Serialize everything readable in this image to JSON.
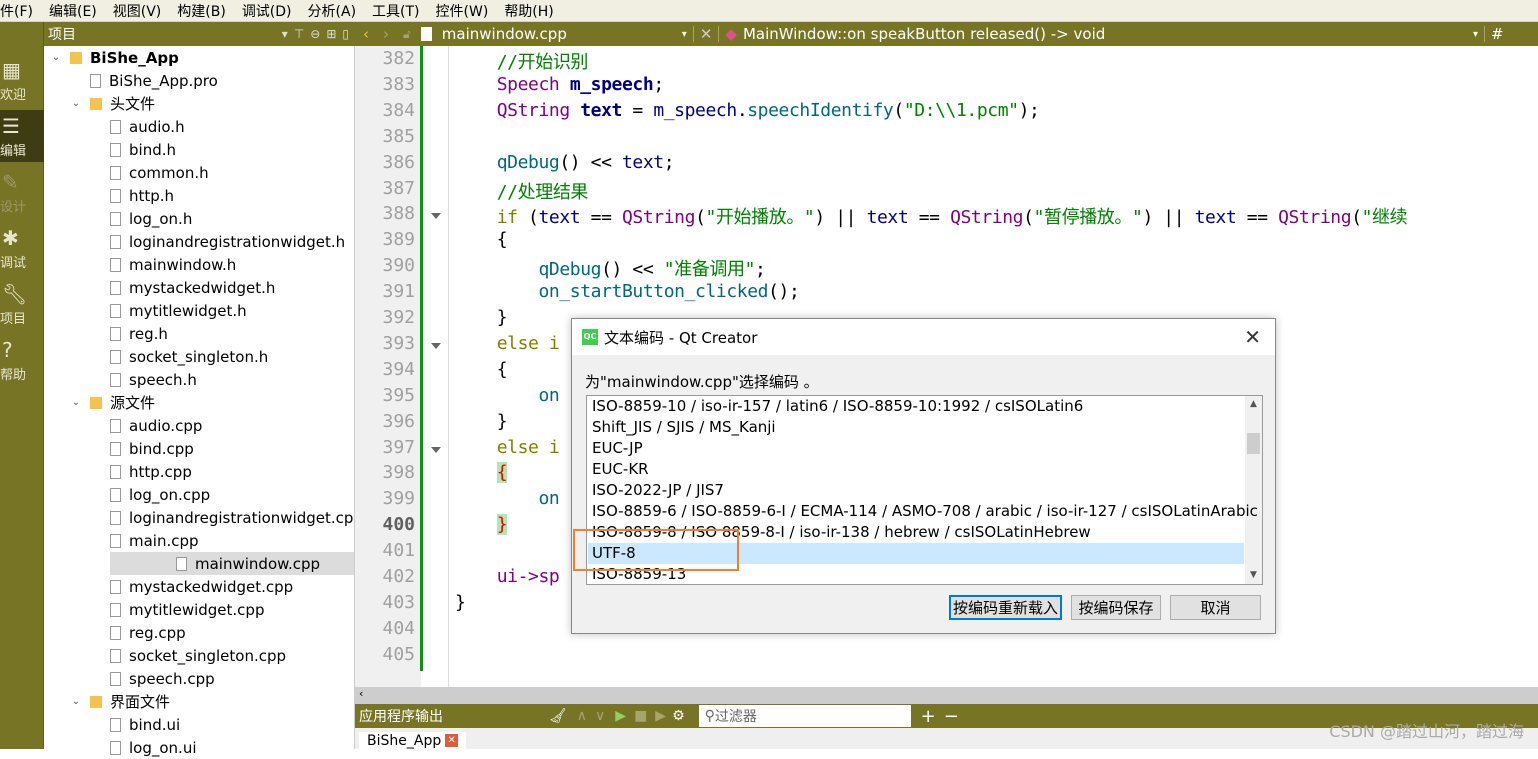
{
  "menu": [
    "件(F)",
    "编辑(E)",
    "视图(V)",
    "构建(B)",
    "调试(D)",
    "分析(A)",
    "工具(T)",
    "控件(W)",
    "帮助(H)"
  ],
  "modes": [
    {
      "label": "欢迎",
      "icon": "grid-icon"
    },
    {
      "label": "编辑",
      "icon": "edit-icon",
      "active": true
    },
    {
      "label": "设计",
      "icon": "pencil-icon",
      "disabled": true
    },
    {
      "label": "调试",
      "icon": "bug-icon"
    },
    {
      "label": "项目",
      "icon": "wrench-icon"
    },
    {
      "label": "帮助",
      "icon": "help-icon"
    }
  ],
  "project": {
    "title": "项目"
  },
  "tree": [
    {
      "label": "BiShe_App",
      "level": 0,
      "type": "project",
      "expanded": true
    },
    {
      "label": "BiShe_App.pro",
      "level": 1,
      "type": "file"
    },
    {
      "label": "头文件",
      "level": 1,
      "type": "folder",
      "expanded": true
    },
    {
      "label": "audio.h",
      "level": 2,
      "type": "file"
    },
    {
      "label": "bind.h",
      "level": 2,
      "type": "file"
    },
    {
      "label": "common.h",
      "level": 2,
      "type": "file"
    },
    {
      "label": "http.h",
      "level": 2,
      "type": "file"
    },
    {
      "label": "log_on.h",
      "level": 2,
      "type": "file"
    },
    {
      "label": "loginandregistrationwidget.h",
      "level": 2,
      "type": "file"
    },
    {
      "label": "mainwindow.h",
      "level": 2,
      "type": "file"
    },
    {
      "label": "mystackedwidget.h",
      "level": 2,
      "type": "file"
    },
    {
      "label": "mytitlewidget.h",
      "level": 2,
      "type": "file"
    },
    {
      "label": "reg.h",
      "level": 2,
      "type": "file"
    },
    {
      "label": "socket_singleton.h",
      "level": 2,
      "type": "file"
    },
    {
      "label": "speech.h",
      "level": 2,
      "type": "file"
    },
    {
      "label": "源文件",
      "level": 1,
      "type": "folder",
      "expanded": true
    },
    {
      "label": "audio.cpp",
      "level": 2,
      "type": "file"
    },
    {
      "label": "bind.cpp",
      "level": 2,
      "type": "file"
    },
    {
      "label": "http.cpp",
      "level": 2,
      "type": "file"
    },
    {
      "label": "log_on.cpp",
      "level": 2,
      "type": "file"
    },
    {
      "label": "loginandregistrationwidget.cp",
      "level": 2,
      "type": "file"
    },
    {
      "label": "main.cpp",
      "level": 2,
      "type": "file"
    },
    {
      "label": "mainwindow.cpp",
      "level": 2,
      "type": "file",
      "selected": true
    },
    {
      "label": "mystackedwidget.cpp",
      "level": 2,
      "type": "file"
    },
    {
      "label": "mytitlewidget.cpp",
      "level": 2,
      "type": "file"
    },
    {
      "label": "reg.cpp",
      "level": 2,
      "type": "file"
    },
    {
      "label": "socket_singleton.cpp",
      "level": 2,
      "type": "file"
    },
    {
      "label": "speech.cpp",
      "level": 2,
      "type": "file"
    },
    {
      "label": "界面文件",
      "level": 1,
      "type": "folder",
      "expanded": true
    },
    {
      "label": "bind.ui",
      "level": 2,
      "type": "file"
    },
    {
      "label": "log_on.ui",
      "level": 2,
      "type": "file"
    }
  ],
  "editor": {
    "file": "mainwindow.cpp",
    "symbol": "MainWindow::on speakButton released() -> void",
    "hash": "#",
    "current_line": 400
  },
  "code": [
    {
      "n": 382,
      "t": [
        [
          "    ",
          ""
        ],
        [
          "//开始识别",
          "cm"
        ]
      ]
    },
    {
      "n": 383,
      "t": [
        [
          "    ",
          ""
        ],
        [
          "Speech ",
          "ty"
        ],
        [
          "m_speech",
          "b"
        ],
        [
          ";",
          ""
        ]
      ]
    },
    {
      "n": 384,
      "t": [
        [
          "    ",
          ""
        ],
        [
          "QString ",
          "ty"
        ],
        [
          "text",
          "b"
        ],
        [
          " = ",
          ""
        ],
        [
          "m_speech",
          "va"
        ],
        [
          ".",
          ""
        ],
        [
          "speechIdentify",
          "fn"
        ],
        [
          "(",
          ""
        ],
        [
          "\"D:\\\\1.pcm\"",
          "st"
        ],
        [
          ");",
          ""
        ]
      ]
    },
    {
      "n": 385,
      "t": []
    },
    {
      "n": 386,
      "t": [
        [
          "    ",
          ""
        ],
        [
          "qDebug",
          "fn"
        ],
        [
          "() << ",
          ""
        ],
        [
          "text",
          "va"
        ],
        [
          ";",
          ""
        ]
      ]
    },
    {
      "n": 387,
      "t": [
        [
          "    ",
          ""
        ],
        [
          "//处理结果",
          "cm"
        ]
      ]
    },
    {
      "n": 388,
      "fold": true,
      "t": [
        [
          "    ",
          ""
        ],
        [
          "if",
          "kw"
        ],
        [
          " (",
          ""
        ],
        [
          "text",
          "va"
        ],
        [
          " == ",
          ""
        ],
        [
          "QString",
          "ty"
        ],
        [
          "(",
          ""
        ],
        [
          "\"开始播放。\"",
          "st"
        ],
        [
          ") || ",
          ""
        ],
        [
          "text",
          "va"
        ],
        [
          " == ",
          ""
        ],
        [
          "QString",
          "ty"
        ],
        [
          "(",
          ""
        ],
        [
          "\"暂停播放。\"",
          "st"
        ],
        [
          ") || ",
          ""
        ],
        [
          "text",
          "va"
        ],
        [
          " == ",
          ""
        ],
        [
          "QString",
          "ty"
        ],
        [
          "(",
          ""
        ],
        [
          "\"继续",
          "st"
        ]
      ]
    },
    {
      "n": 389,
      "t": [
        [
          "    {",
          ""
        ]
      ]
    },
    {
      "n": 390,
      "t": [
        [
          "        ",
          ""
        ],
        [
          "qDebug",
          "fn"
        ],
        [
          "() << ",
          ""
        ],
        [
          "\"准备调用\"",
          "st"
        ],
        [
          ";",
          ""
        ]
      ]
    },
    {
      "n": 391,
      "t": [
        [
          "        ",
          ""
        ],
        [
          "on_startButton_clicked",
          "fn"
        ],
        [
          "();",
          ""
        ]
      ]
    },
    {
      "n": 392,
      "t": [
        [
          "    }",
          ""
        ]
      ]
    },
    {
      "n": 393,
      "fold": true,
      "t": [
        [
          "    ",
          ""
        ],
        [
          "else i",
          "kw"
        ]
      ]
    },
    {
      "n": 394,
      "t": [
        [
          "    {",
          ""
        ]
      ]
    },
    {
      "n": 395,
      "t": [
        [
          "        ",
          ""
        ],
        [
          "on",
          "fn"
        ]
      ]
    },
    {
      "n": 396,
      "t": [
        [
          "    }",
          ""
        ]
      ]
    },
    {
      "n": 397,
      "fold": true,
      "t": [
        [
          "    ",
          ""
        ],
        [
          "else i",
          "kw"
        ]
      ]
    },
    {
      "n": 398,
      "t": [
        [
          "    ",
          ""
        ],
        [
          "{",
          "bm"
        ]
      ]
    },
    {
      "n": 399,
      "t": [
        [
          "        ",
          ""
        ],
        [
          "on",
          "fn"
        ]
      ]
    },
    {
      "n": 400,
      "t": [
        [
          "    ",
          ""
        ],
        [
          "}",
          "bm"
        ]
      ]
    },
    {
      "n": 401,
      "t": []
    },
    {
      "n": 402,
      "t": [
        [
          "    ",
          ""
        ],
        [
          "ui->sp",
          "ty"
        ]
      ]
    },
    {
      "n": 403,
      "t": [
        [
          "}",
          ""
        ]
      ]
    },
    {
      "n": 404,
      "t": []
    },
    {
      "n": 405,
      "t": []
    }
  ],
  "output": {
    "title": "应用程序输出",
    "filter_placeholder": "过滤器",
    "tab": "BiShe_App"
  },
  "watermark": "CSDN @踏过山河，踏过海",
  "dialog": {
    "title": "文本编码 - Qt Creator",
    "prompt": "为\"mainwindow.cpp\"选择编码 。",
    "options": [
      "ISO-8859-10 / iso-ir-157 / latin6 / ISO-8859-10:1992 / csISOLatin6",
      "Shift_JIS / SJIS / MS_Kanji",
      "EUC-JP",
      "EUC-KR",
      "ISO-2022-JP / JIS7",
      "ISO-8859-6 / ISO-8859-6-I / ECMA-114 / ASMO-708 / arabic / iso-ir-127 / csISOLatinArabic",
      "ISO-8859-8 / ISO 8859-8-I / iso-ir-138 / hebrew / csISOLatinHebrew",
      "UTF-8",
      "ISO-8859-13"
    ],
    "selected": "UTF-8",
    "buttons": {
      "reload": "按编码重新载入",
      "save": "按编码保存",
      "cancel": "取消"
    }
  },
  "colors": {
    "accent": "#787425",
    "selection": "#cce8ff",
    "highlight_box": "#f08030"
  }
}
